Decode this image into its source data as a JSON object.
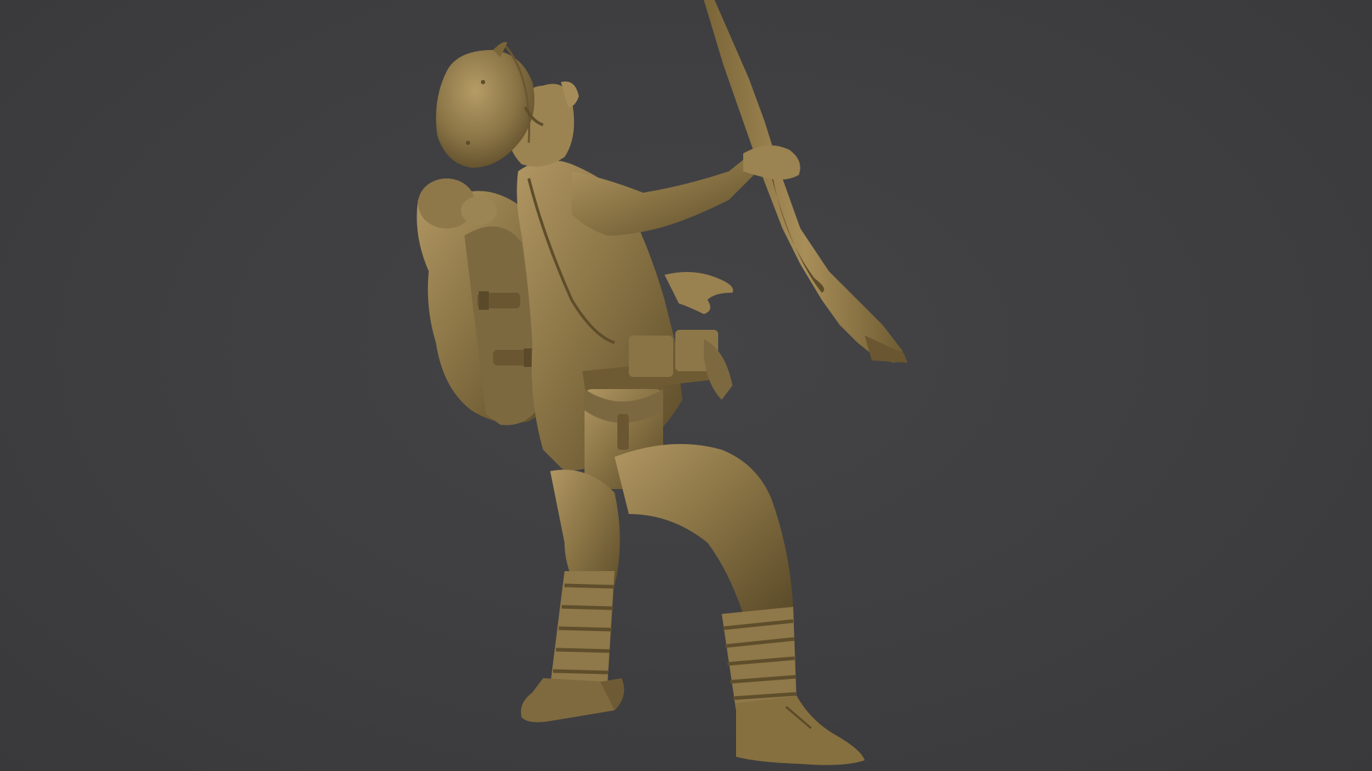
{
  "scene": {
    "subject": "",
    "background_color": "#3f3f41",
    "model_color": "#8b7546",
    "model_highlight": "#b09662",
    "model_shadow": "#5a4a28"
  }
}
